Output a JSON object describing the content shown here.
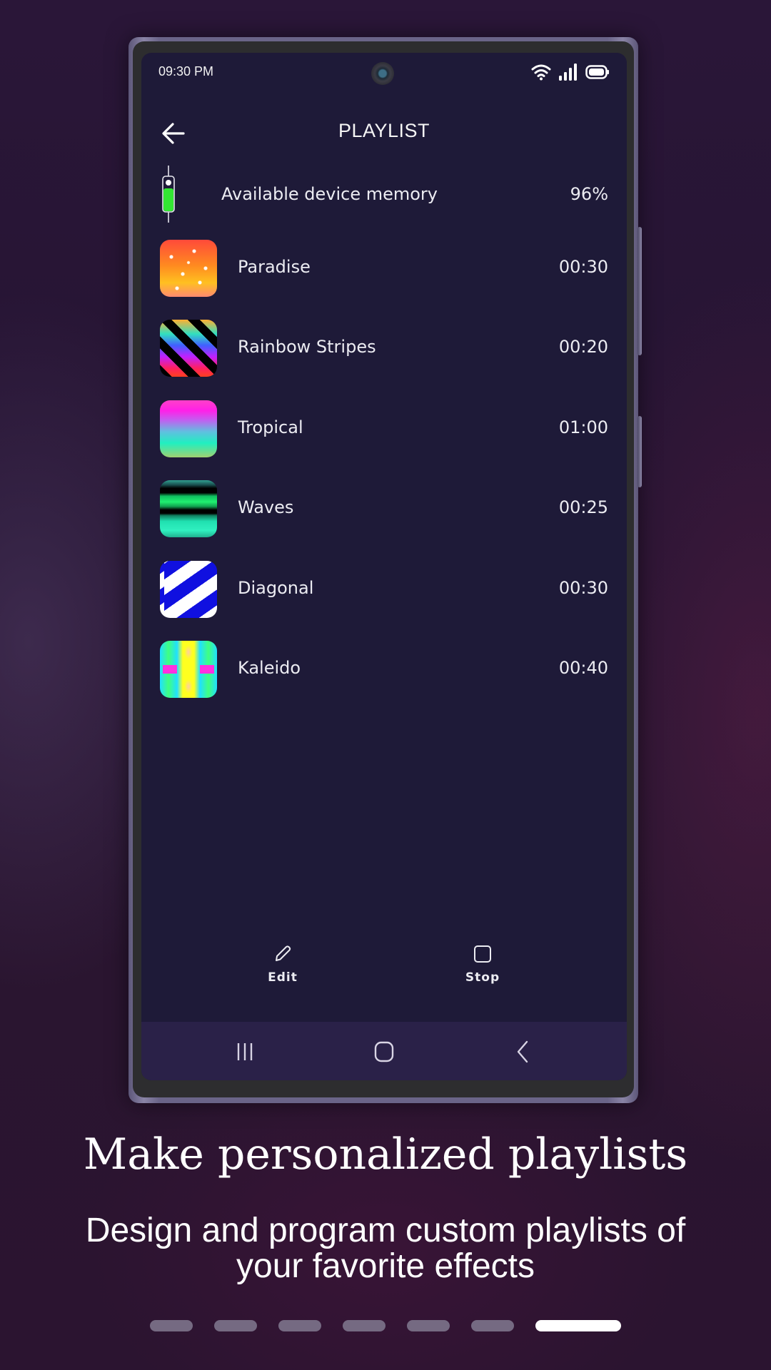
{
  "status_bar": {
    "time": "09:30 PM",
    "icons": [
      "wifi-icon",
      "signal-icon",
      "battery-icon"
    ]
  },
  "header": {
    "back_icon": "arrow-left-icon",
    "title": "PLAYLIST"
  },
  "memory": {
    "icon": "memory-gauge-icon",
    "label": "Available device memory",
    "value": "96%",
    "fraction": 0.96,
    "fill_color": "#33e633"
  },
  "playlist": {
    "items": [
      {
        "name": "Paradise",
        "duration": "00:30",
        "thumb": "paradise"
      },
      {
        "name": "Rainbow Stripes",
        "duration": "00:20",
        "thumb": "rainbow"
      },
      {
        "name": "Tropical",
        "duration": "01:00",
        "thumb": "tropical"
      },
      {
        "name": "Waves",
        "duration": "00:25",
        "thumb": "waves"
      },
      {
        "name": "Diagonal",
        "duration": "00:30",
        "thumb": "diagonal"
      },
      {
        "name": "Kaleido",
        "duration": "00:40",
        "thumb": "kaleido"
      }
    ]
  },
  "actions": {
    "edit_label": "Edit",
    "stop_label": "Stop"
  },
  "nav_bar": {
    "recents_icon": "recents-icon",
    "home_icon": "home-icon",
    "back_icon": "back-chevron-icon"
  },
  "caption": {
    "title": "Make personalized playlists",
    "subtitle": "Design and program custom playlists of your favorite effects"
  },
  "pager": {
    "total": 7,
    "active_index": 6
  },
  "colors": {
    "screen_bg": "#1e1a38",
    "nav_bg": "#2a2148",
    "text": "#ececf2"
  }
}
